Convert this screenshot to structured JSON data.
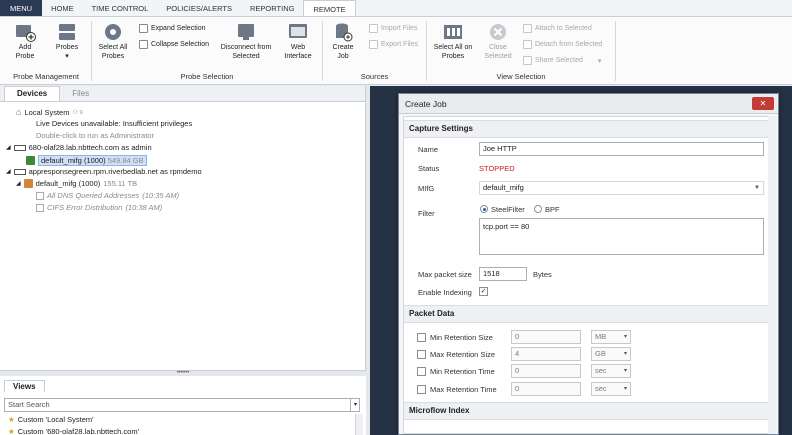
{
  "tabs": [
    "MENU",
    "HOME",
    "TIME CONTROL",
    "POLICIES/ALERTS",
    "REPORTING",
    "REMOTE"
  ],
  "ribbon": {
    "add_probe": "Add\nProbe",
    "probes": "Probes\n▾",
    "select_all_probes": "Select All\nProbes",
    "expand_selection": "Expand Selection",
    "collapse_selection": "Collapse Selection",
    "disconnect": "Disconnect from\nSelected",
    "web_interface": "Web\nInterface",
    "create_job": "Create\nJob",
    "import_files": "Import Files",
    "export_files": "Export Files",
    "select_all_on_probes": "Select All on\nProbes",
    "close_selected": "Close\nSelected",
    "attach_to_selected": "Attach to Selected",
    "detach_from_selected": "Detach from Selected",
    "share_selected": "Share Selected",
    "groups": [
      "Probe Management",
      "Probe Selection",
      "Sources",
      "View Selection"
    ]
  },
  "left_tabs": [
    "Devices",
    "Files"
  ],
  "tree": {
    "local_system": "Local System",
    "live_unavailable": "Live Devices unavailable: Insufficient privileges",
    "run_admin": "Double-click to run as Administrator",
    "host1": "680-olaf28.lab.nbttech.com as admin",
    "host1_mifg": "default_mifg (1000)",
    "host1_mifg_size": "549.84 GB",
    "host2": "appresponsegreen.rpm.riverbedlab.net as rpmdemo",
    "host2_mifg": "default_mifg (1000)",
    "host2_mifg_size": "155.11 TB",
    "view1": "All DNS Queried Addresses",
    "view1_time": "(10:35 AM)",
    "view2": "CIFS Error Distribution",
    "view2_time": "(10:38 AM)"
  },
  "views": {
    "title": "Views",
    "search_placeholder": "Start Search",
    "item1": "Custom 'Local System'",
    "item2": "Custom '680-olaf28.lab.nbttech.com'"
  },
  "dialog": {
    "title": "Create Job",
    "capture_settings": "Capture Settings",
    "name_label": "Name",
    "name_value": "Joe HTTP",
    "status_label": "Status",
    "status_value": "STOPPED",
    "mifg_label": "MIfG",
    "mifg_value": "default_mifg",
    "filter_label": "Filter",
    "steelfilter": "SteelFilter",
    "bpf": "BPF",
    "filter_value": "tcp.port == 80",
    "max_packet_label": "Max packet size",
    "max_packet_value": "1518",
    "bytes": "Bytes",
    "enable_indexing": "Enable Indexing",
    "packet_data": "Packet Data",
    "min_ret_size": "Min Retention Size",
    "max_ret_size": "Max Retention Size",
    "min_ret_time": "Min Retention Time",
    "max_ret_time": "Max Retention Time",
    "min_ret_size_val": "0",
    "max_ret_size_val": "4",
    "min_ret_time_val": "0",
    "max_ret_time_val": "0",
    "unit_mb": "MB",
    "unit_gb": "GB",
    "unit_sec1": "sec",
    "unit_sec2": "sec",
    "microflow_index": "Microflow Index"
  },
  "colors": {
    "menu_bg": "#2a3a55",
    "status_stopped": "#c3261f",
    "dark_bg": "#263246",
    "close_btn": "#c23b36"
  }
}
